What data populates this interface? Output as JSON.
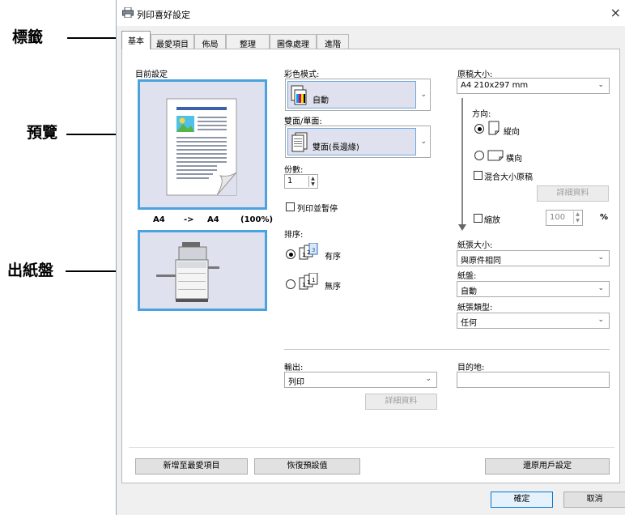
{
  "callouts": {
    "tabs": "標籤",
    "preview": "預覽",
    "output_tray": "出紙盤"
  },
  "window": {
    "title": "列印喜好設定",
    "close": "×"
  },
  "tabs": [
    "基本",
    "最愛項目",
    "佈局",
    "整理",
    "圖像處理",
    "進階"
  ],
  "current_settings": {
    "label": "目前設定",
    "size_from": "A4",
    "arrow": "->",
    "size_to": "A4",
    "zoom": "(100%)"
  },
  "color_mode": {
    "label": "彩色模式:",
    "value": "自動"
  },
  "duplex": {
    "label": "雙面/單面:",
    "value": "雙面(長邊緣)"
  },
  "copies": {
    "label": "份數:",
    "value": "1"
  },
  "print_pause": {
    "label": "列印並暫停",
    "checked": false
  },
  "sort": {
    "label": "排序:",
    "options": [
      {
        "label": "有序",
        "selected": true
      },
      {
        "label": "無序",
        "selected": false
      }
    ]
  },
  "original_size": {
    "label": "原稿大小:",
    "value": "A4 210x297 mm"
  },
  "orientation": {
    "label": "方向:",
    "options": [
      {
        "label": "縱向",
        "selected": true
      },
      {
        "label": "橫向",
        "selected": false
      }
    ]
  },
  "mixed_size": {
    "label": "混合大小原稿",
    "checked": false
  },
  "details_button_1": "詳細資料",
  "zoom": {
    "label": "縮放",
    "checked": false,
    "value": "100",
    "unit": "%"
  },
  "paper_size": {
    "label": "紙張大小:",
    "value": "與原件相同"
  },
  "tray": {
    "label": "紙盤:",
    "value": "自動"
  },
  "paper_type": {
    "label": "紙張類型:",
    "value": "任何"
  },
  "output": {
    "label": "輸出:",
    "value": "列印"
  },
  "details_button_2": "詳細資料",
  "destination": {
    "label": "目的地:",
    "value": ""
  },
  "buttons": {
    "add_favorite": "新增至最愛項目",
    "restore_defaults": "恢復預設值",
    "restore_user": "還原用戶設定",
    "ok": "確定",
    "cancel": "取消"
  },
  "colors": {
    "accent": "#4aa3df",
    "preview_bg": "#dfe1ee",
    "window_bg": "#f0f0f0"
  }
}
